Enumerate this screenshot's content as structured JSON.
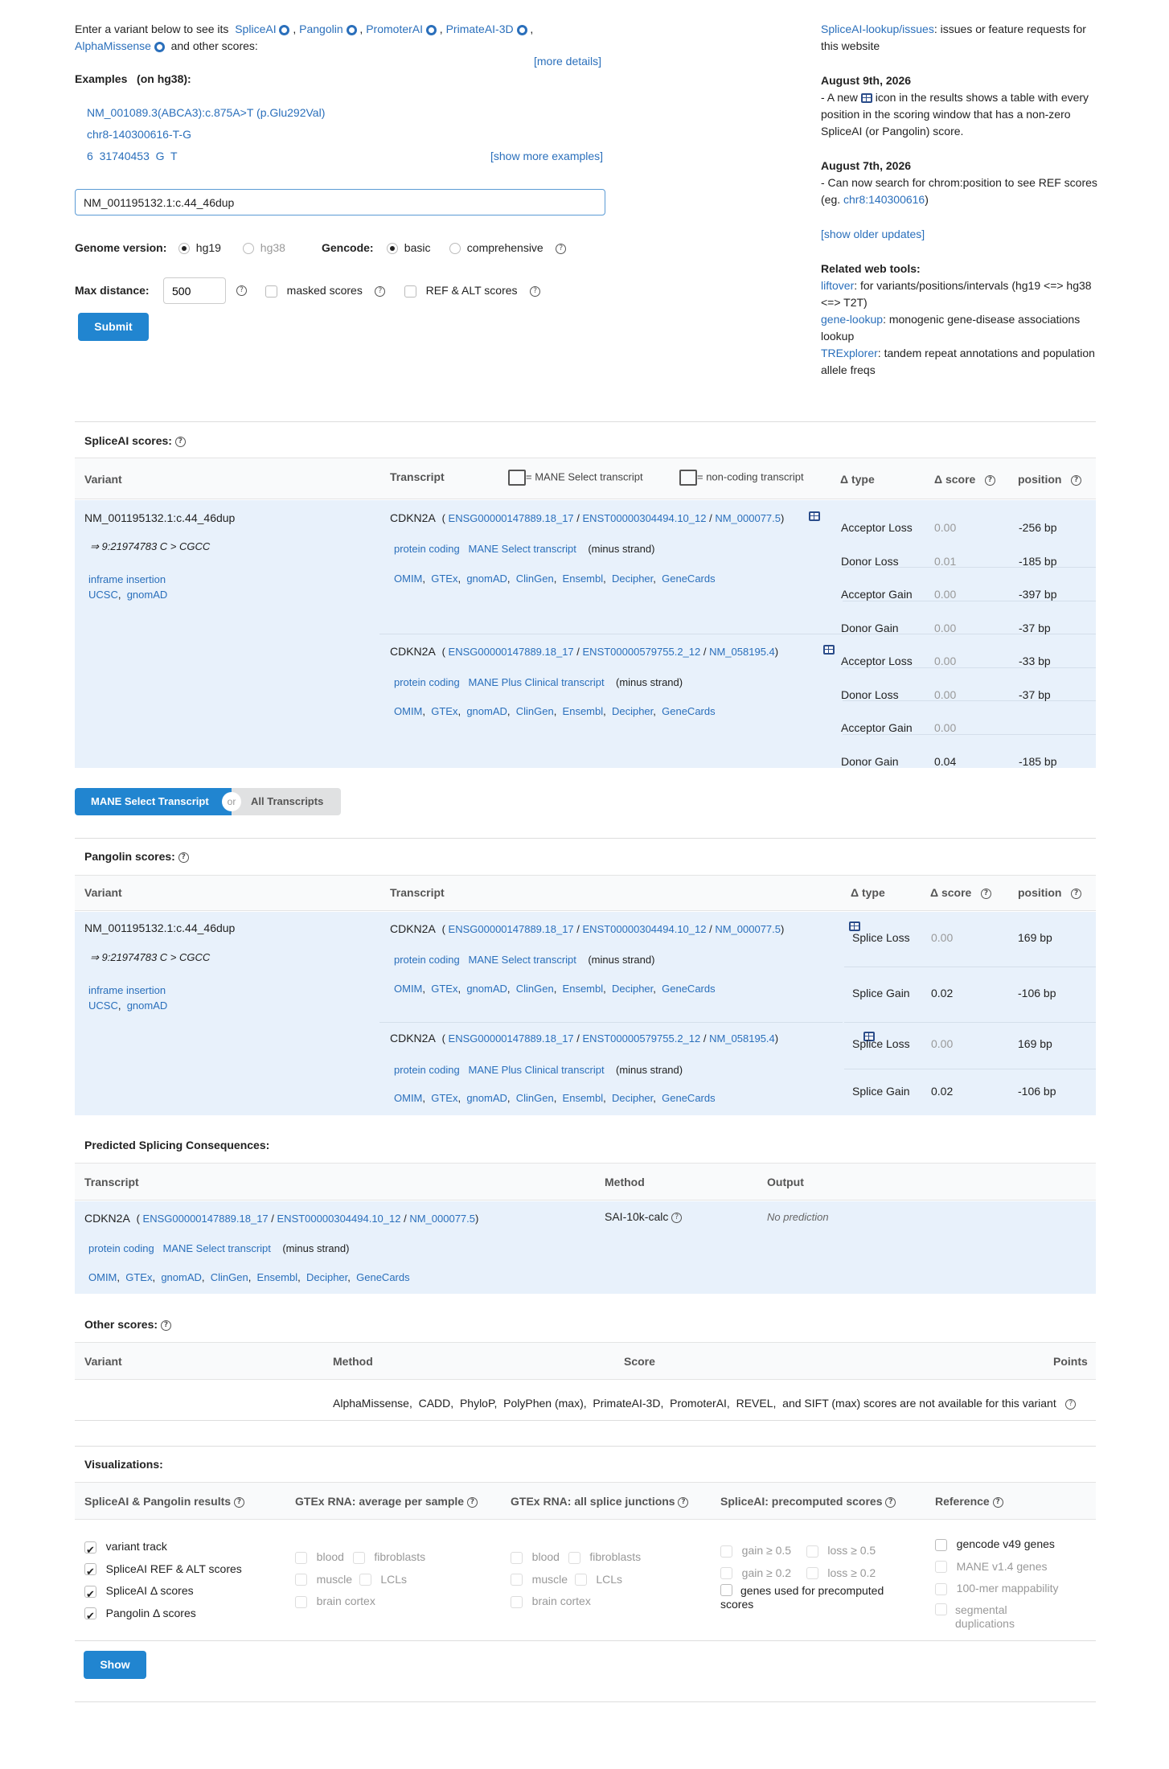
{
  "intro": {
    "lead": "Enter a variant below to see its",
    "links": [
      "SpliceAI",
      "Pangolin",
      "PromoterAI",
      "PrimateAI-3D",
      "AlphaMissense"
    ],
    "tail": "and other scores:",
    "more_details": "[more details]"
  },
  "examples": {
    "title": "Examples",
    "subtitle": "(on hg38):",
    "items": [
      "NM_001089.3(ABCA3):c.875A>T (p.Glu292Val)",
      "chr8-140300616-T-G",
      "6  31740453  G  T"
    ],
    "show_more": "[show more examples]"
  },
  "search": {
    "value": "NM_001195132.1:c.44_46dup"
  },
  "form": {
    "genome_label": "Genome version:",
    "genome_options": [
      "hg19",
      "hg38"
    ],
    "gencode_label": "Gencode:",
    "gencode_options": [
      "basic",
      "comprehensive"
    ],
    "maxdist_label": "Max distance:",
    "maxdist_value": "500",
    "masked": "masked scores",
    "refalt": "REF & ALT scores",
    "submit": "Submit"
  },
  "sidebar": {
    "issues_link": "SpliceAI-lookup/issues",
    "issues_text": ": issues or feature requests for this website",
    "u1_date": "August 9th, 2026",
    "u1_a": "- A new",
    "u1_b": "icon in the results shows a table with every position in the scoring window that has a non-zero SpliceAI (or Pangolin) score.",
    "u2_date": "August 7th, 2026",
    "u2_a": "- Can now search for chrom:position to see REF scores (eg.",
    "u2_link": "chr8:140300616",
    "u2_b": ")",
    "older": "[show older updates]",
    "tools_title": "Related web tools:",
    "t1_link": "liftover",
    "t1_text": ": for variants/positions/intervals (hg19 <=> hg38 <=> T2T)",
    "t2_link": "gene-lookup",
    "t2_text": ": monogenic gene-disease associations lookup",
    "t3_link": "TRExplorer",
    "t3_text": ": tandem repeat annotations and population allele freqs"
  },
  "spliceai": {
    "title": "SpliceAI scores:",
    "headers": {
      "variant": "Variant",
      "transcript": "Transcript",
      "mane": "= MANE Select transcript",
      "noncoding": "= non-coding transcript",
      "dtype": "Δ type",
      "dscore": "Δ score",
      "position": "position"
    },
    "variant": {
      "name": "NM_001195132.1:c.44_46dup",
      "hg": "⇒ 9:21974783 C > CGCC",
      "effect": "inframe insertion",
      "ucsc": "UCSC",
      "gnomad": "gnomAD"
    },
    "tx1": {
      "gene": "CDKN2A",
      "ensg": "ENSG00000147889.18_17",
      "enst": "ENST00000304494.10_12",
      "nm": "NM_000077.5",
      "biotype": "protein coding",
      "tag": "MANE Select transcript",
      "strand": "(minus strand)"
    },
    "tx2": {
      "gene": "CDKN2A",
      "ensg": "ENSG00000147889.18_17",
      "enst": "ENST00000579755.2_12",
      "nm": "NM_058195.4",
      "biotype": "protein coding",
      "tag": "MANE Plus Clinical transcript",
      "strand": "(minus strand)"
    },
    "links": [
      "OMIM",
      "GTEx",
      "gnomAD",
      "ClinGen",
      "Ensembl",
      "Decipher",
      "GeneCards"
    ],
    "rows1": [
      {
        "t": "Acceptor Loss",
        "s": "0.00",
        "p": "-256 bp"
      },
      {
        "t": "Donor Loss",
        "s": "0.01",
        "p": "-185 bp"
      },
      {
        "t": "Acceptor Gain",
        "s": "0.00",
        "p": "-397 bp"
      },
      {
        "t": "Donor Gain",
        "s": "0.00",
        "p": "-37 bp"
      }
    ],
    "rows2": [
      {
        "t": "Acceptor Loss",
        "s": "0.00",
        "p": "-33 bp"
      },
      {
        "t": "Donor Loss",
        "s": "0.00",
        "p": "-37 bp"
      },
      {
        "t": "Acceptor Gain",
        "s": "0.00",
        "p": ""
      },
      {
        "t": "Donor Gain",
        "s": "0.04",
        "p": "-185 bp"
      }
    ]
  },
  "toggle": {
    "mane": "MANE Select Transcript",
    "or": "or",
    "all": "All Transcripts"
  },
  "pangolin": {
    "title": "Pangolin scores:",
    "rows1": [
      {
        "t": "Splice Loss",
        "s": "0.00",
        "p": "169 bp"
      },
      {
        "t": "Splice Gain",
        "s": "0.02",
        "p": "-106 bp"
      }
    ],
    "rows2": [
      {
        "t": "Splice Loss",
        "s": "0.00",
        "p": "169 bp"
      },
      {
        "t": "Splice Gain",
        "s": "0.02",
        "p": "-106 bp"
      }
    ]
  },
  "psc": {
    "title": "Predicted Splicing Consequences:",
    "h_tx": "Transcript",
    "h_method": "Method",
    "h_output": "Output",
    "method": "SAI-10k-calc",
    "output": "No prediction"
  },
  "other": {
    "title": "Other scores:",
    "h_variant": "Variant",
    "h_method": "Method",
    "h_score": "Score",
    "h_points": "Points",
    "message": "AlphaMissense,  CADD,  PhyloP,  PolyPhen (max),  PrimateAI-3D,  PromoterAI,  REVEL,  and SIFT (max) scores are not available for this variant"
  },
  "viz": {
    "title": "Visualizations:",
    "cols": [
      "SpliceAI & Pangolin results",
      "GTEx RNA: average per sample",
      "GTEx RNA: all splice junctions",
      "SpliceAI: precomputed scores",
      "Reference"
    ],
    "c1": [
      "variant track",
      "SpliceAI REF & ALT scores",
      "SpliceAI Δ  scores",
      "Pangolin Δ  scores"
    ],
    "gtex": [
      "blood",
      "fibroblasts",
      "muscle",
      "LCLs",
      "brain cortex"
    ],
    "pre": [
      "gain ≥ 0.5",
      "loss ≥ 0.5",
      "gain ≥ 0.2",
      "loss ≥ 0.2",
      "genes used for precomputed scores"
    ],
    "ref": [
      "gencode v49 genes",
      "MANE v1.4 genes",
      "100-mer mappability",
      "segmental duplications"
    ],
    "show": "Show"
  },
  "colors": {
    "accent": "#2185d0",
    "link": "#2a6fbb",
    "band": "#e8f1fb"
  }
}
